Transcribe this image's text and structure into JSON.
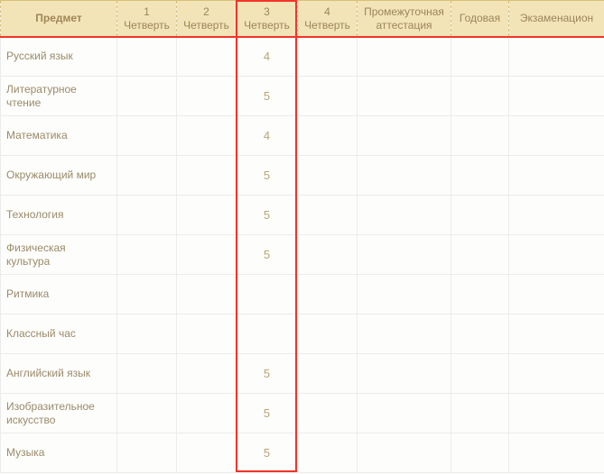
{
  "columns": {
    "subject": "Предмет",
    "q1_a": "1",
    "q1_b": "Четверть",
    "q2_a": "2",
    "q2_b": "Четверть",
    "q3_a": "3",
    "q3_b": "Четверть",
    "q4_a": "4",
    "q4_b": "Четверть",
    "interim_a": "Промежуточная",
    "interim_b": "аттестация",
    "annual": "Годовая",
    "exam": "Экзаменацион"
  },
  "rows": [
    {
      "subject": "Русский язык",
      "q1": "",
      "q2": "",
      "q3": "4",
      "q4": "",
      "interim": "",
      "annual": "",
      "exam": ""
    },
    {
      "subject": "Литературное чтение",
      "q1": "",
      "q2": "",
      "q3": "5",
      "q4": "",
      "interim": "",
      "annual": "",
      "exam": ""
    },
    {
      "subject": "Математика",
      "q1": "",
      "q2": "",
      "q3": "4",
      "q4": "",
      "interim": "",
      "annual": "",
      "exam": ""
    },
    {
      "subject": "Окружающий мир",
      "q1": "",
      "q2": "",
      "q3": "5",
      "q4": "",
      "interim": "",
      "annual": "",
      "exam": ""
    },
    {
      "subject": "Технология",
      "q1": "",
      "q2": "",
      "q3": "5",
      "q4": "",
      "interim": "",
      "annual": "",
      "exam": ""
    },
    {
      "subject": "Физическая культура",
      "q1": "",
      "q2": "",
      "q3": "5",
      "q4": "",
      "interim": "",
      "annual": "",
      "exam": ""
    },
    {
      "subject": "Ритмика",
      "q1": "",
      "q2": "",
      "q3": "",
      "q4": "",
      "interim": "",
      "annual": "",
      "exam": ""
    },
    {
      "subject": "Классный час",
      "q1": "",
      "q2": "",
      "q3": "",
      "q4": "",
      "interim": "",
      "annual": "",
      "exam": ""
    },
    {
      "subject": "Английский язык",
      "q1": "",
      "q2": "",
      "q3": "5",
      "q4": "",
      "interim": "",
      "annual": "",
      "exam": ""
    },
    {
      "subject": "Изобразительное искусство",
      "q1": "",
      "q2": "",
      "q3": "5",
      "q4": "",
      "interim": "",
      "annual": "",
      "exam": ""
    },
    {
      "subject": "Музыка",
      "q1": "",
      "q2": "",
      "q3": "5",
      "q4": "",
      "interim": "",
      "annual": "",
      "exam": ""
    }
  ],
  "chart_data": {
    "type": "table",
    "title": "Оценки по предметам (четверти)",
    "columns": [
      "Предмет",
      "1 Четверть",
      "2 Четверть",
      "3 Четверть",
      "4 Четверть",
      "Промежуточная аттестация",
      "Годовая",
      "Экзаменационная"
    ],
    "data": [
      [
        "Русский язык",
        null,
        null,
        4,
        null,
        null,
        null,
        null
      ],
      [
        "Литературное чтение",
        null,
        null,
        5,
        null,
        null,
        null,
        null
      ],
      [
        "Математика",
        null,
        null,
        4,
        null,
        null,
        null,
        null
      ],
      [
        "Окружающий мир",
        null,
        null,
        5,
        null,
        null,
        null,
        null
      ],
      [
        "Технология",
        null,
        null,
        5,
        null,
        null,
        null,
        null
      ],
      [
        "Физическая культура",
        null,
        null,
        5,
        null,
        null,
        null,
        null
      ],
      [
        "Ритмика",
        null,
        null,
        null,
        null,
        null,
        null,
        null
      ],
      [
        "Классный час",
        null,
        null,
        null,
        null,
        null,
        null,
        null
      ],
      [
        "Английский язык",
        null,
        null,
        5,
        null,
        null,
        null,
        null
      ],
      [
        "Изобразительное искусство",
        null,
        null,
        5,
        null,
        null,
        null,
        null
      ],
      [
        "Музыка",
        null,
        null,
        5,
        null,
        null,
        null,
        null
      ]
    ]
  }
}
